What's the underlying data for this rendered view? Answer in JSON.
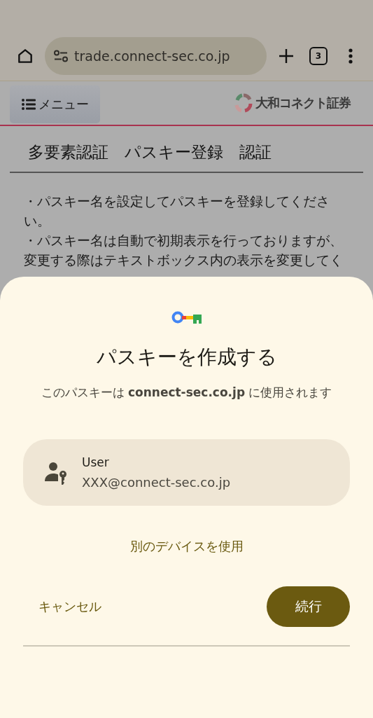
{
  "browser_bar": {
    "url": "trade.connect-sec.co.jp",
    "tab_count": "3"
  },
  "site_header": {
    "menu_button": "メニュー",
    "logo_text": "大和コネクト証券"
  },
  "page": {
    "heading": "多要素認証　パスキー登録　認証",
    "paragraphs": [
      "・パスキー名を設定してパスキーを登録してください。",
      "・パスキー名は自動で初期表示を行っておりますが、変更する際はテキストボックス内の表示を変更してく"
    ]
  },
  "sheet": {
    "title": "パスキーを作成する",
    "subtitle": "このパスキーは **connect-sec.co.jp** に使用されます",
    "account": {
      "name": "User",
      "email": "XXX@connect-sec.co.jp"
    },
    "other_device_link": "別のデバイスを使用",
    "cancel_button": "キャンセル",
    "continue_button": "続行"
  }
}
